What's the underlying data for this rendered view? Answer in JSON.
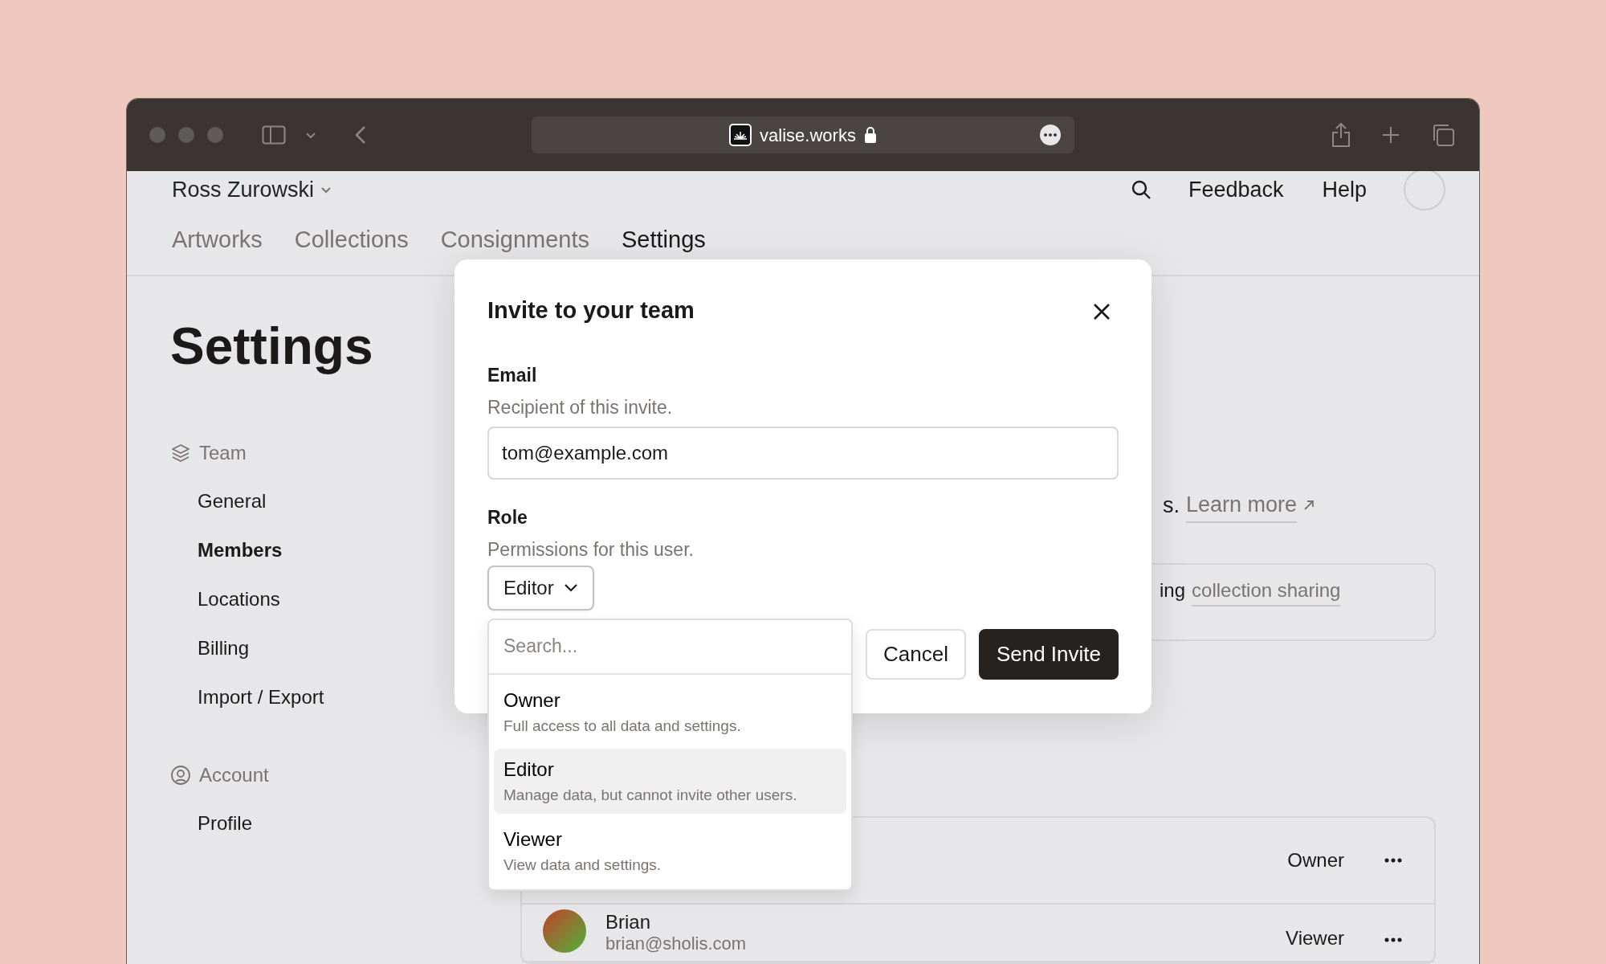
{
  "browser": {
    "url": "valise.works"
  },
  "header": {
    "account_name": "Ross Zurowski",
    "links": [
      "Feedback",
      "Help"
    ]
  },
  "tabs": [
    {
      "label": "Artworks",
      "selected": false
    },
    {
      "label": "Collections",
      "selected": false
    },
    {
      "label": "Consignments",
      "selected": false
    },
    {
      "label": "Settings",
      "selected": true
    }
  ],
  "page_title": "Settings",
  "sidebar": {
    "sections": [
      {
        "kind": "team",
        "label": "Team",
        "items": [
          {
            "label": "General",
            "selected": false
          },
          {
            "label": "Members",
            "selected": true
          },
          {
            "label": "Locations",
            "selected": false
          },
          {
            "label": "Billing",
            "selected": false
          },
          {
            "label": "Import / Export",
            "selected": false
          }
        ]
      },
      {
        "kind": "account",
        "label": "Account",
        "items": [
          {
            "label": "Profile",
            "selected": false
          }
        ]
      }
    ]
  },
  "main": {
    "description_tail": "s.",
    "learn_more": "Learn more",
    "notice_tail": "ing",
    "notice_link": "collection sharing",
    "members": [
      {
        "role": "Owner"
      },
      {
        "name": "Brian",
        "email": "brian@sholis.com",
        "role": "Viewer"
      }
    ]
  },
  "modal": {
    "title": "Invite to your team",
    "fields": [
      {
        "kind": "text",
        "label": "Email",
        "hint": "Recipient of this invite.",
        "value": "tom@example.com"
      },
      {
        "kind": "select",
        "label": "Role",
        "hint": "Permissions for this user.",
        "value": "Editor",
        "expanded": true
      }
    ],
    "dropdown": {
      "placeholder": "Search...",
      "options": [
        {
          "label": "Owner",
          "description": "Full access to all data and settings.",
          "selected": false
        },
        {
          "label": "Editor",
          "description": "Manage data, but cannot invite other users.",
          "selected": true
        },
        {
          "label": "Viewer",
          "description": "View data and settings.",
          "selected": false
        }
      ]
    },
    "buttons": [
      {
        "kind": "secondary",
        "label": "Cancel"
      },
      {
        "kind": "primary",
        "label": "Send Invite"
      }
    ]
  }
}
